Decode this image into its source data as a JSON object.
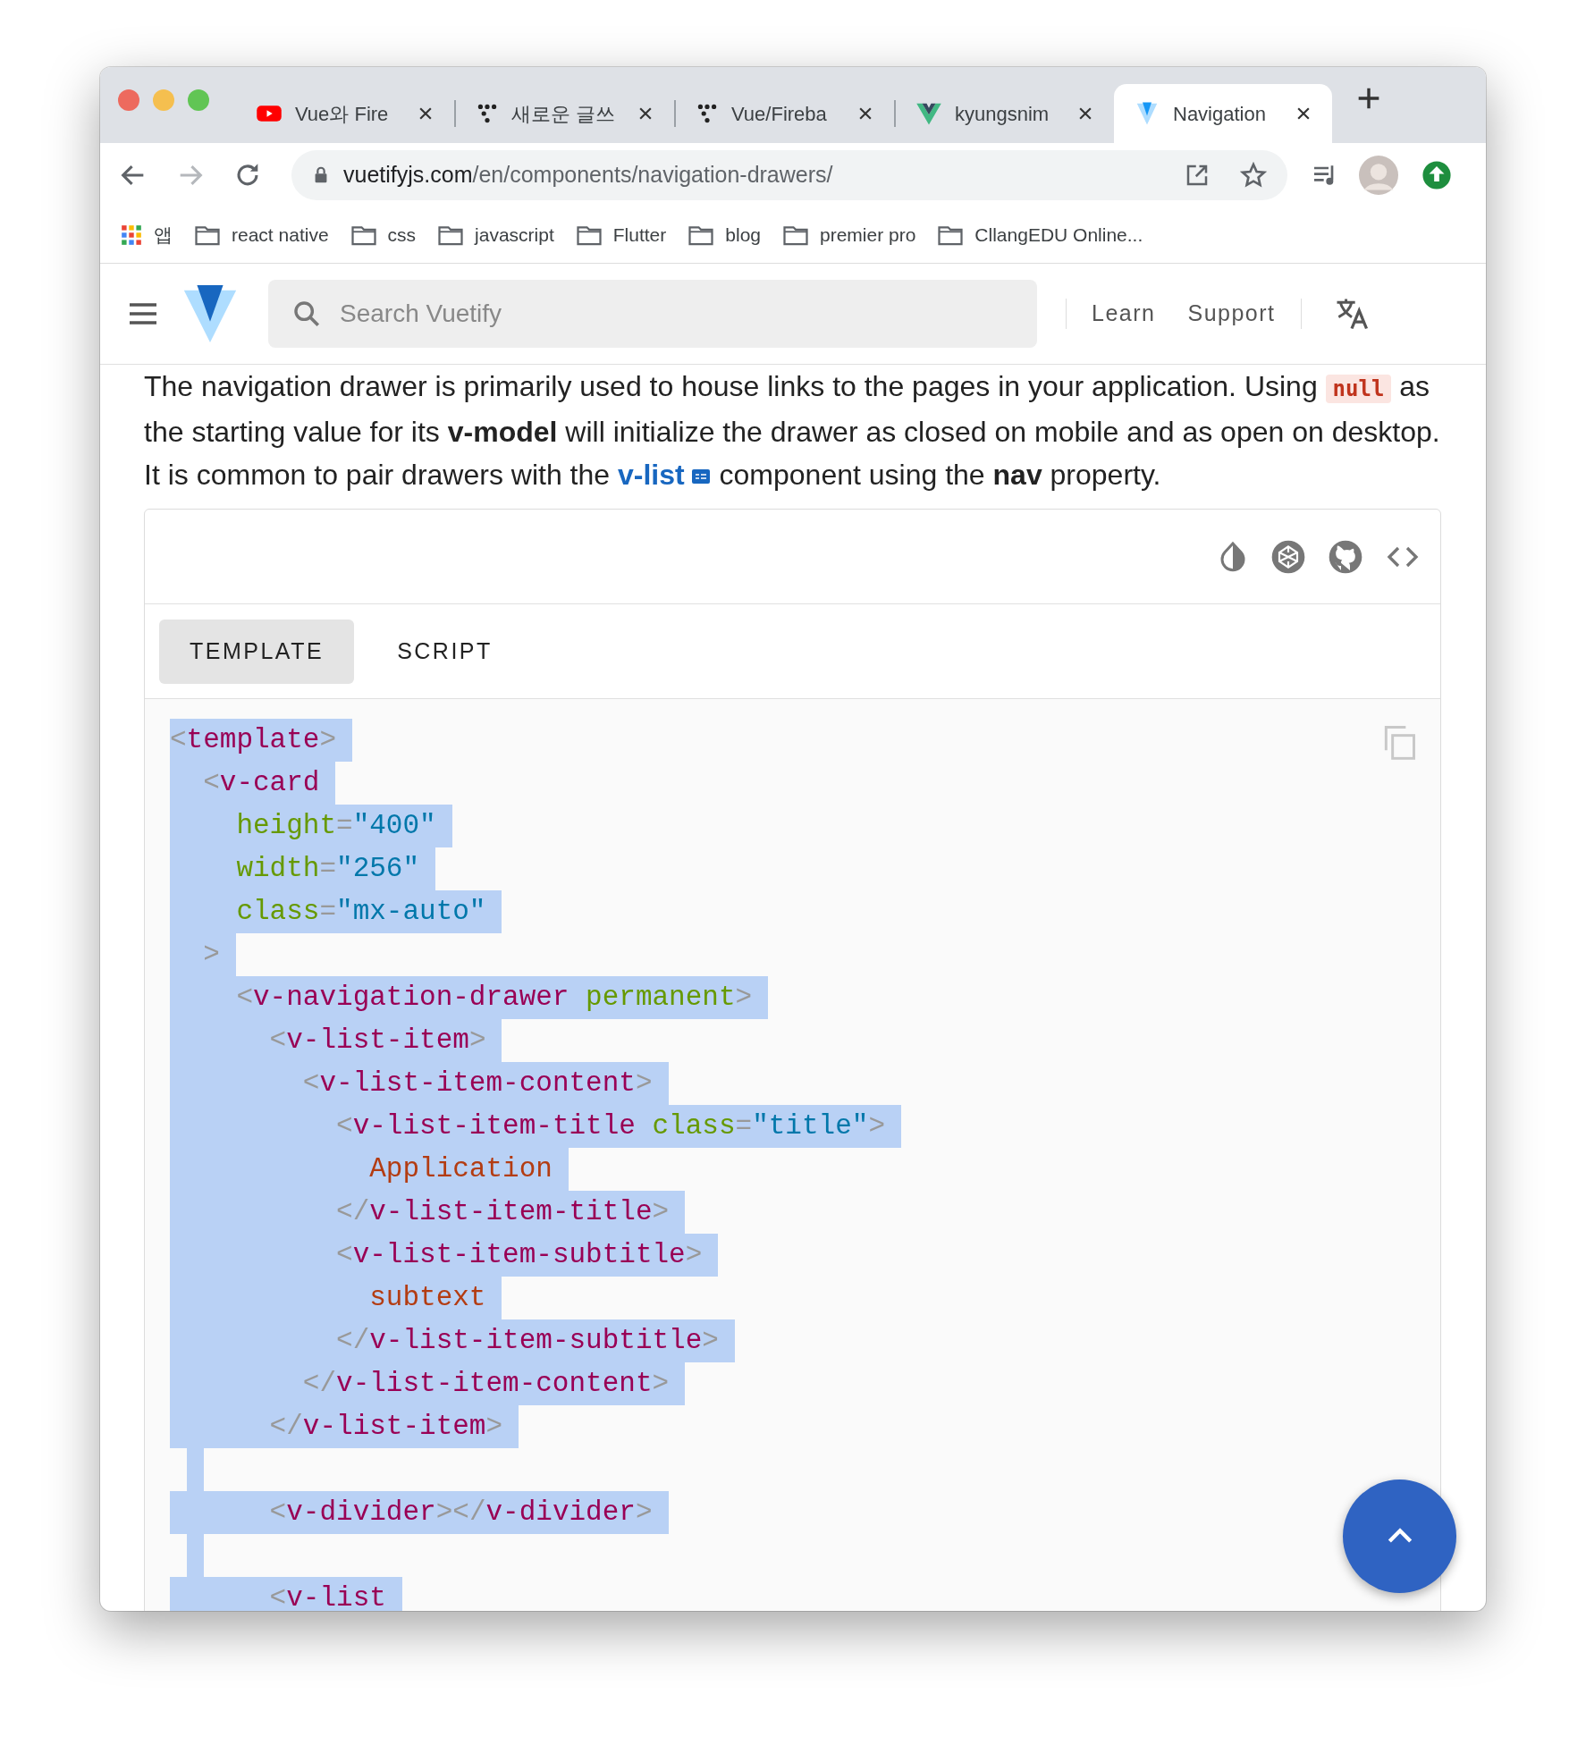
{
  "browser": {
    "tabs": [
      {
        "kind": "youtube",
        "title": "Vue와 Fire",
        "selected": false
      },
      {
        "kind": "dots",
        "title": "새로운 글쓰",
        "selected": false
      },
      {
        "kind": "dots",
        "title": "Vue/Fireba",
        "selected": false
      },
      {
        "kind": "vue",
        "title": "kyungsnim",
        "selected": false
      },
      {
        "kind": "vuetify",
        "title": "Navigation",
        "selected": true
      }
    ],
    "nav_buttons": [
      {
        "kind": "back",
        "disabled": false
      },
      {
        "kind": "forward",
        "disabled": true
      },
      {
        "kind": "reload",
        "disabled": false
      }
    ],
    "address": {
      "host": "vuetifyjs.com",
      "path": "/en/components/navigation-drawers/"
    },
    "bookmarks": [
      {
        "kind": "apps",
        "label": "앱"
      },
      {
        "kind": "folder",
        "label": "react native"
      },
      {
        "kind": "folder",
        "label": "css"
      },
      {
        "kind": "folder",
        "label": "javascript"
      },
      {
        "kind": "folder",
        "label": "Flutter"
      },
      {
        "kind": "folder",
        "label": "blog"
      },
      {
        "kind": "folder",
        "label": "premier pro"
      },
      {
        "kind": "folder",
        "label": "CllangEDU Online..."
      }
    ]
  },
  "header": {
    "search": {
      "placeholder": "Search Vuetify"
    },
    "links": [
      "Learn",
      "Support"
    ]
  },
  "intro": [
    [
      {
        "kind": "text",
        "text": "The navigation drawer is primarily used to house links to the pages in your application. Using "
      },
      {
        "kind": "code",
        "text": "null"
      },
      {
        "kind": "text",
        "text": " as"
      }
    ],
    [
      {
        "kind": "text",
        "text": "the starting value for its **v-model** will initialize the drawer as closed on mobile and as open on desktop."
      }
    ],
    [
      {
        "kind": "text",
        "text": "It is common to pair drawers with the "
      },
      {
        "kind": "link",
        "text": "v-list"
      },
      {
        "kind": "text",
        "text": " component using the **nav** property."
      }
    ]
  ],
  "example": {
    "tabs": [
      {
        "label": "TEMPLATE",
        "selected": true
      },
      {
        "label": "SCRIPT",
        "selected": false
      }
    ],
    "code": [
      {
        "selected": true,
        "tokens": [
          {
            "kind": "punct",
            "text": "<"
          },
          {
            "kind": "tag",
            "text": "template"
          },
          {
            "kind": "punct",
            "text": ">"
          }
        ]
      },
      {
        "selected": true,
        "tokens": [
          {
            "kind": "punct",
            "text": "  <"
          },
          {
            "kind": "tag",
            "text": "v-card"
          }
        ]
      },
      {
        "selected": true,
        "tokens": [
          {
            "kind": "attr",
            "text": "    height"
          },
          {
            "kind": "punct",
            "text": "="
          },
          {
            "kind": "value",
            "text": "\"400\""
          }
        ]
      },
      {
        "selected": true,
        "tokens": [
          {
            "kind": "attr",
            "text": "    width"
          },
          {
            "kind": "punct",
            "text": "="
          },
          {
            "kind": "value",
            "text": "\"256\""
          }
        ]
      },
      {
        "selected": true,
        "tokens": [
          {
            "kind": "attr",
            "text": "    class"
          },
          {
            "kind": "punct",
            "text": "="
          },
          {
            "kind": "value",
            "text": "\"mx-auto\""
          }
        ]
      },
      {
        "selected": true,
        "tokens": [
          {
            "kind": "punct",
            "text": "  >"
          }
        ]
      },
      {
        "selected": true,
        "tokens": [
          {
            "kind": "punct",
            "text": "    <"
          },
          {
            "kind": "tag",
            "text": "v-navigation-drawer"
          },
          {
            "kind": "attr",
            "text": " permanent"
          },
          {
            "kind": "punct",
            "text": ">"
          }
        ]
      },
      {
        "selected": true,
        "tokens": [
          {
            "kind": "punct",
            "text": "      <"
          },
          {
            "kind": "tag",
            "text": "v-list-item"
          },
          {
            "kind": "punct",
            "text": ">"
          }
        ]
      },
      {
        "selected": true,
        "tokens": [
          {
            "kind": "punct",
            "text": "        <"
          },
          {
            "kind": "tag",
            "text": "v-list-item-content"
          },
          {
            "kind": "punct",
            "text": ">"
          }
        ]
      },
      {
        "selected": true,
        "tokens": [
          {
            "kind": "punct",
            "text": "          <"
          },
          {
            "kind": "tag",
            "text": "v-list-item-title"
          },
          {
            "kind": "attr",
            "text": " class"
          },
          {
            "kind": "punct",
            "text": "="
          },
          {
            "kind": "value",
            "text": "\"title\""
          },
          {
            "kind": "punct",
            "text": ">"
          }
        ]
      },
      {
        "selected": true,
        "tokens": [
          {
            "kind": "content",
            "text": "            Application"
          }
        ]
      },
      {
        "selected": true,
        "tokens": [
          {
            "kind": "punct",
            "text": "          </"
          },
          {
            "kind": "tag",
            "text": "v-list-item-title"
          },
          {
            "kind": "punct",
            "text": ">"
          }
        ]
      },
      {
        "selected": true,
        "tokens": [
          {
            "kind": "punct",
            "text": "          <"
          },
          {
            "kind": "tag",
            "text": "v-list-item-subtitle"
          },
          {
            "kind": "punct",
            "text": ">"
          }
        ]
      },
      {
        "selected": true,
        "tokens": [
          {
            "kind": "content",
            "text": "            subtext"
          }
        ]
      },
      {
        "selected": true,
        "tokens": [
          {
            "kind": "punct",
            "text": "          </"
          },
          {
            "kind": "tag",
            "text": "v-list-item-subtitle"
          },
          {
            "kind": "punct",
            "text": ">"
          }
        ]
      },
      {
        "selected": true,
        "tokens": [
          {
            "kind": "punct",
            "text": "        </"
          },
          {
            "kind": "tag",
            "text": "v-list-item-content"
          },
          {
            "kind": "punct",
            "text": ">"
          }
        ]
      },
      {
        "selected": true,
        "tokens": [
          {
            "kind": "punct",
            "text": "      </"
          },
          {
            "kind": "tag",
            "text": "v-list-item"
          },
          {
            "kind": "punct",
            "text": ">"
          }
        ]
      },
      {
        "kind": "blank",
        "selected": true
      },
      {
        "selected": true,
        "tokens": [
          {
            "kind": "punct",
            "text": "      <"
          },
          {
            "kind": "tag",
            "text": "v-divider"
          },
          {
            "kind": "punct",
            "text": "></"
          },
          {
            "kind": "tag",
            "text": "v-divider"
          },
          {
            "kind": "punct",
            "text": ">"
          }
        ]
      },
      {
        "kind": "blank",
        "selected": true
      },
      {
        "selected": true,
        "tokens": [
          {
            "kind": "punct",
            "text": "      <"
          },
          {
            "kind": "tag",
            "text": "v-list"
          }
        ]
      }
    ]
  }
}
